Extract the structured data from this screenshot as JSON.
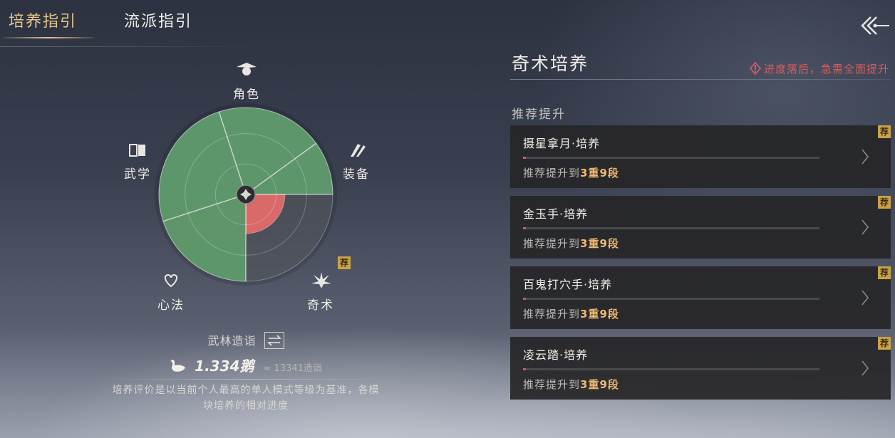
{
  "tabs": {
    "active_label": "培养指引",
    "inactive_label": "流派指引"
  },
  "radar": {
    "axes": {
      "role": "角色",
      "equipment": "装备",
      "martial": "武学",
      "heart": "心法",
      "qishu": "奇术"
    },
    "recommend_badge": "荐",
    "colors": {
      "good": "#5f9a6c",
      "bad": "#e26a6a",
      "empty": "#5a5c62"
    },
    "levels": {
      "role": 1.0,
      "equipment": 1.0,
      "qishu": 0.45,
      "heart": 1.0,
      "martial": 1.0
    }
  },
  "rating": {
    "title": "武林造诣",
    "value": "1.334鹅",
    "approx": "≈ 13341造诣",
    "description": "培养评价是以当前个人最高的单人模式等级为基准，各模块培养的相对进度"
  },
  "panel": {
    "title": "奇术培养",
    "warning": "进度落后，急需全面提升",
    "section_label": "推荐提升",
    "cards": [
      {
        "name": "摄星拿月·培养",
        "hint_prefix": "推荐提升到",
        "hint_target": "3重9段",
        "badge": "荐",
        "progress": 0.01
      },
      {
        "name": "金玉手·培养",
        "hint_prefix": "推荐提升到",
        "hint_target": "3重9段",
        "badge": "荐",
        "progress": 0.01
      },
      {
        "name": "百鬼打穴手·培养",
        "hint_prefix": "推荐提升到",
        "hint_target": "3重9段",
        "badge": "荐",
        "progress": 0.01
      },
      {
        "name": "凌云踏·培养",
        "hint_prefix": "推荐提升到",
        "hint_target": "3重9段",
        "badge": "荐",
        "progress": 0.01
      }
    ]
  }
}
